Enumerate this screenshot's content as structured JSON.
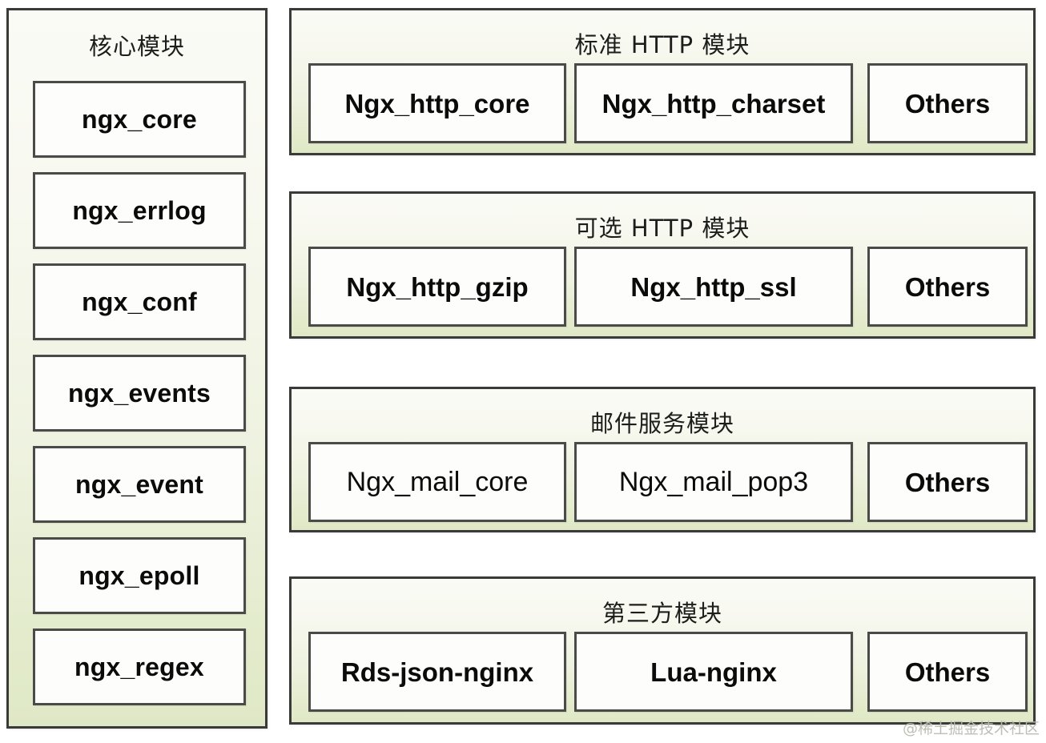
{
  "diagram": {
    "title_text": "",
    "core_panel": {
      "title": "核心模块",
      "modules": [
        {
          "label": "ngx_core"
        },
        {
          "label": "ngx_errlog"
        },
        {
          "label": "ngx_conf"
        },
        {
          "label": "ngx_events"
        },
        {
          "label": "ngx_event"
        },
        {
          "label": "ngx_epoll"
        },
        {
          "label": "ngx_regex"
        }
      ]
    },
    "groups": [
      {
        "title": "标准 HTTP 模块",
        "weight": "bold",
        "modules": [
          {
            "label": "Ngx_http_core"
          },
          {
            "label": "Ngx_http_charset"
          },
          {
            "label": "Others"
          }
        ]
      },
      {
        "title": "可选 HTTP 模块",
        "weight": "bold",
        "modules": [
          {
            "label": "Ngx_http_gzip"
          },
          {
            "label": "Ngx_http_ssl"
          },
          {
            "label": "Others"
          }
        ]
      },
      {
        "title": "邮件服务模块",
        "weight": "light",
        "modules": [
          {
            "label": "Ngx_mail_core"
          },
          {
            "label": "Ngx_mail_pop3"
          },
          {
            "label": "Others"
          }
        ]
      },
      {
        "title": "第三方模块",
        "weight": "bold",
        "modules": [
          {
            "label": "Rds-json-nginx"
          },
          {
            "label": "Lua-nginx"
          },
          {
            "label": "Others"
          }
        ]
      }
    ],
    "watermark": "@稀土掘金技术社区",
    "colors": {
      "panel_border": "#3a3a38",
      "box_border": "#4a4a48",
      "panel_gradient_top": "#fbfbf6",
      "panel_gradient_bottom": "#dfe8c6",
      "box_fill": "#fdfdfb",
      "text": "#0b0b0b",
      "watermark": "#b9bdb0"
    }
  }
}
